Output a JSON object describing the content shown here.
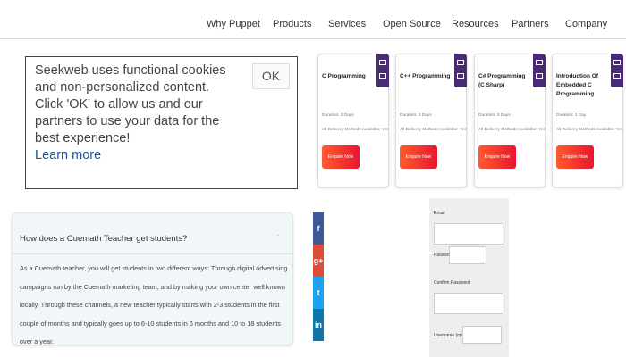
{
  "nav": {
    "items": [
      "Why Puppet",
      "Products",
      "Services",
      "Open Source",
      "Resources",
      "Partners",
      "Company"
    ]
  },
  "cookie": {
    "message": "Seekweb uses functional cookies and non-personalized content. Click 'OK' to allow us and our partners to use your data for the best experience!",
    "link": "Learn more",
    "ok_label": "OK"
  },
  "courses": [
    {
      "title": "C Programming",
      "duration": "Duration: 2 Days",
      "delivery": "All Delivery Methods Available: Yes",
      "button": "Enquire Now"
    },
    {
      "title": "C++ Programming",
      "duration": "Duration: 3 Days",
      "delivery": "All Delivery Methods Available: Yes",
      "button": "Enquire Now"
    },
    {
      "title": "C# Programming (C Sharp)",
      "duration": "Duration: 3 Days",
      "delivery": "All Delivery Methods Available: Yes",
      "button": "Enquire Now"
    },
    {
      "title": "Introduction Of Embedded C Programming",
      "duration": "Duration: 1 Day",
      "delivery": "All Delivery Methods Available: Yes",
      "button": "Enquire Now"
    }
  ],
  "faq": {
    "question": "How does a Cuemath Teacher get students?",
    "answer": "As a Cuemath teacher, you will get students in two different ways: Through digital advertising campaigns run by the Cuemath marketing team, and by making your own center well known locally. Through these channels, a new teacher typically starts with 2-3 students in the first couple of months and typically goes up to 6-10 students in 6 months and 10 to 18 students over a year."
  },
  "social": [
    {
      "glyph": "f",
      "icon": "facebook-icon",
      "color": "#3b5998"
    },
    {
      "glyph": "g+",
      "icon": "google-plus-icon",
      "color": "#dd4b39"
    },
    {
      "glyph": "t",
      "icon": "twitter-icon",
      "color": "#1da1f2"
    },
    {
      "glyph": "in",
      "icon": "linkedin-icon",
      "color": "#0e76a8"
    }
  ],
  "form": {
    "email_label": "Email",
    "password_label": "Password",
    "confirm_label": "Confirm Password",
    "username_label": "Username (optional)"
  },
  "colors": {
    "accent_purple": "#4a2a73",
    "enquire_start": "#ff5b2e",
    "enquire_end": "#e8162f",
    "link": "#1f4fa0"
  }
}
